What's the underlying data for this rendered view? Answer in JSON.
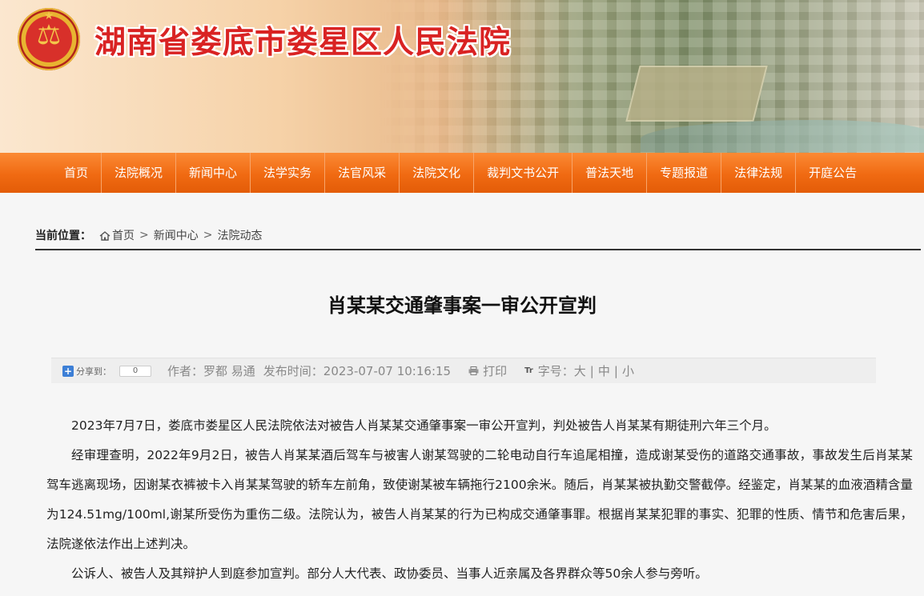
{
  "site": {
    "court_name": "湖南省娄底市娄星区人民法院"
  },
  "nav": {
    "items": [
      "首页",
      "法院概况",
      "新闻中心",
      "法学实务",
      "法官风采",
      "法院文化",
      "裁判文书公开",
      "普法天地",
      "专题报道",
      "法律法规",
      "开庭公告"
    ]
  },
  "breadcrumb": {
    "label": "当前位置：",
    "home": "首页",
    "level1": "新闻中心",
    "level2": "法院动态",
    "separator": ">"
  },
  "article": {
    "title": "肖某某交通肇事案一审公开宣判",
    "share_label": "分享到：",
    "share_count": "0",
    "author": "作者：罗都 易通",
    "published": "发布时间：2023-07-07 10:16:15",
    "print_label": "打印",
    "font_label": "字号：",
    "font_large": "大",
    "font_medium": "中",
    "font_small": "小",
    "font_sep": "|",
    "paragraphs": [
      "2023年7月7日，娄底市娄星区人民法院依法对被告人肖某某交通肇事案一审公开宣判，判处被告人肖某某有期徒刑六年三个月。",
      "经审理查明，2022年9月2日，被告人肖某某酒后驾车与被害人谢某驾驶的二轮电动自行车追尾相撞，造成谢某受伤的道路交通事故，事故发生后肖某某驾车逃离现场，因谢某衣裤被卡入肖某某驾驶的轿车左前角，致使谢某被车辆拖行2100余米。随后，肖某某被执勤交警截停。经鉴定，肖某某的血液酒精含量为124.51mg/100ml,谢某所受伤为重伤二级。法院认为，被告人肖某某的行为已构成交通肇事罪。根据肖某某犯罪的事实、犯罪的性质、情节和危害后果，法院遂依法作出上述判决。",
      "公诉人、被告人及其辩护人到庭参加宣判。部分人大代表、政协委员、当事人近亲属及各界群众等50余人参与旁听。"
    ]
  },
  "icons": {
    "emblem": "court-emblem",
    "home": "home-icon",
    "share": "share-plus-icon",
    "print": "printer-icon",
    "font": "font-size-icon"
  },
  "colors": {
    "nav_orange": "#f06a12",
    "court_name_red": "#d92323"
  }
}
